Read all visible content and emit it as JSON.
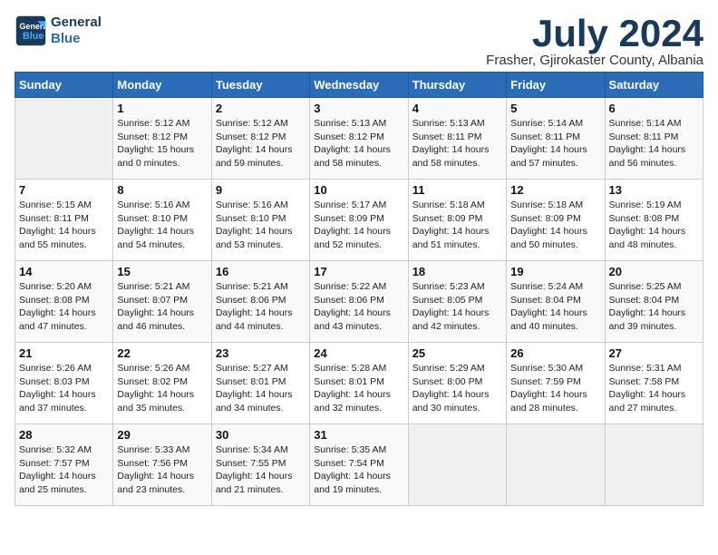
{
  "header": {
    "logo_line1": "General",
    "logo_line2": "Blue",
    "month": "July 2024",
    "location": "Frasher, Gjirokaster County, Albania"
  },
  "days_of_week": [
    "Sunday",
    "Monday",
    "Tuesday",
    "Wednesday",
    "Thursday",
    "Friday",
    "Saturday"
  ],
  "weeks": [
    [
      {
        "num": "",
        "info": ""
      },
      {
        "num": "1",
        "info": "Sunrise: 5:12 AM\nSunset: 8:12 PM\nDaylight: 15 hours\nand 0 minutes."
      },
      {
        "num": "2",
        "info": "Sunrise: 5:12 AM\nSunset: 8:12 PM\nDaylight: 14 hours\nand 59 minutes."
      },
      {
        "num": "3",
        "info": "Sunrise: 5:13 AM\nSunset: 8:12 PM\nDaylight: 14 hours\nand 58 minutes."
      },
      {
        "num": "4",
        "info": "Sunrise: 5:13 AM\nSunset: 8:11 PM\nDaylight: 14 hours\nand 58 minutes."
      },
      {
        "num": "5",
        "info": "Sunrise: 5:14 AM\nSunset: 8:11 PM\nDaylight: 14 hours\nand 57 minutes."
      },
      {
        "num": "6",
        "info": "Sunrise: 5:14 AM\nSunset: 8:11 PM\nDaylight: 14 hours\nand 56 minutes."
      }
    ],
    [
      {
        "num": "7",
        "info": "Sunrise: 5:15 AM\nSunset: 8:11 PM\nDaylight: 14 hours\nand 55 minutes."
      },
      {
        "num": "8",
        "info": "Sunrise: 5:16 AM\nSunset: 8:10 PM\nDaylight: 14 hours\nand 54 minutes."
      },
      {
        "num": "9",
        "info": "Sunrise: 5:16 AM\nSunset: 8:10 PM\nDaylight: 14 hours\nand 53 minutes."
      },
      {
        "num": "10",
        "info": "Sunrise: 5:17 AM\nSunset: 8:09 PM\nDaylight: 14 hours\nand 52 minutes."
      },
      {
        "num": "11",
        "info": "Sunrise: 5:18 AM\nSunset: 8:09 PM\nDaylight: 14 hours\nand 51 minutes."
      },
      {
        "num": "12",
        "info": "Sunrise: 5:18 AM\nSunset: 8:09 PM\nDaylight: 14 hours\nand 50 minutes."
      },
      {
        "num": "13",
        "info": "Sunrise: 5:19 AM\nSunset: 8:08 PM\nDaylight: 14 hours\nand 48 minutes."
      }
    ],
    [
      {
        "num": "14",
        "info": "Sunrise: 5:20 AM\nSunset: 8:08 PM\nDaylight: 14 hours\nand 47 minutes."
      },
      {
        "num": "15",
        "info": "Sunrise: 5:21 AM\nSunset: 8:07 PM\nDaylight: 14 hours\nand 46 minutes."
      },
      {
        "num": "16",
        "info": "Sunrise: 5:21 AM\nSunset: 8:06 PM\nDaylight: 14 hours\nand 44 minutes."
      },
      {
        "num": "17",
        "info": "Sunrise: 5:22 AM\nSunset: 8:06 PM\nDaylight: 14 hours\nand 43 minutes."
      },
      {
        "num": "18",
        "info": "Sunrise: 5:23 AM\nSunset: 8:05 PM\nDaylight: 14 hours\nand 42 minutes."
      },
      {
        "num": "19",
        "info": "Sunrise: 5:24 AM\nSunset: 8:04 PM\nDaylight: 14 hours\nand 40 minutes."
      },
      {
        "num": "20",
        "info": "Sunrise: 5:25 AM\nSunset: 8:04 PM\nDaylight: 14 hours\nand 39 minutes."
      }
    ],
    [
      {
        "num": "21",
        "info": "Sunrise: 5:26 AM\nSunset: 8:03 PM\nDaylight: 14 hours\nand 37 minutes."
      },
      {
        "num": "22",
        "info": "Sunrise: 5:26 AM\nSunset: 8:02 PM\nDaylight: 14 hours\nand 35 minutes."
      },
      {
        "num": "23",
        "info": "Sunrise: 5:27 AM\nSunset: 8:01 PM\nDaylight: 14 hours\nand 34 minutes."
      },
      {
        "num": "24",
        "info": "Sunrise: 5:28 AM\nSunset: 8:01 PM\nDaylight: 14 hours\nand 32 minutes."
      },
      {
        "num": "25",
        "info": "Sunrise: 5:29 AM\nSunset: 8:00 PM\nDaylight: 14 hours\nand 30 minutes."
      },
      {
        "num": "26",
        "info": "Sunrise: 5:30 AM\nSunset: 7:59 PM\nDaylight: 14 hours\nand 28 minutes."
      },
      {
        "num": "27",
        "info": "Sunrise: 5:31 AM\nSunset: 7:58 PM\nDaylight: 14 hours\nand 27 minutes."
      }
    ],
    [
      {
        "num": "28",
        "info": "Sunrise: 5:32 AM\nSunset: 7:57 PM\nDaylight: 14 hours\nand 25 minutes."
      },
      {
        "num": "29",
        "info": "Sunrise: 5:33 AM\nSunset: 7:56 PM\nDaylight: 14 hours\nand 23 minutes."
      },
      {
        "num": "30",
        "info": "Sunrise: 5:34 AM\nSunset: 7:55 PM\nDaylight: 14 hours\nand 21 minutes."
      },
      {
        "num": "31",
        "info": "Sunrise: 5:35 AM\nSunset: 7:54 PM\nDaylight: 14 hours\nand 19 minutes."
      },
      {
        "num": "",
        "info": ""
      },
      {
        "num": "",
        "info": ""
      },
      {
        "num": "",
        "info": ""
      }
    ]
  ]
}
